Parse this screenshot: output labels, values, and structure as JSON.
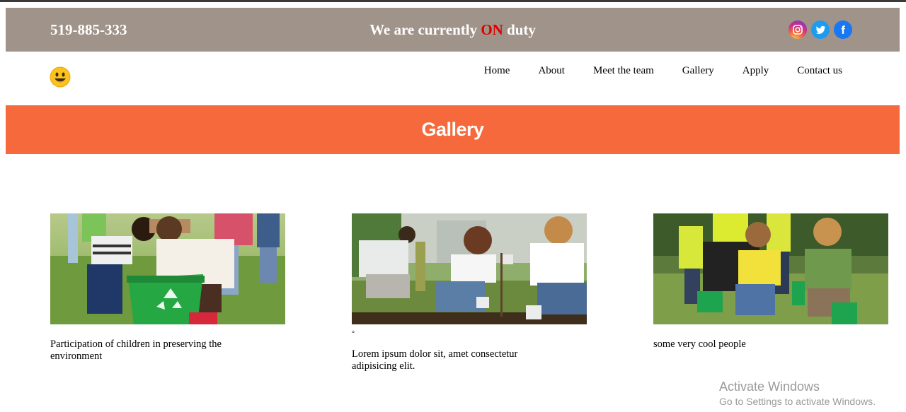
{
  "header": {
    "phone": "519-885-333",
    "duty_prefix": "We are currently ",
    "duty_highlight": "ON",
    "duty_suffix": " duty",
    "highlight_color": "#e00000",
    "bar_color": "#a09389",
    "socials": [
      {
        "icon": "instagram-icon"
      },
      {
        "icon": "twitter-icon"
      },
      {
        "icon": "facebook-icon"
      }
    ]
  },
  "nav": {
    "logo_icon": "smiley-icon",
    "items": [
      {
        "label": "Home"
      },
      {
        "label": "About"
      },
      {
        "label": "Meet the team"
      },
      {
        "label": "Gallery"
      },
      {
        "label": "Apply"
      },
      {
        "label": "Contact us"
      }
    ]
  },
  "banner": {
    "title": "Gallery",
    "color": "#f5693c"
  },
  "gallery": [
    {
      "caption": "Participation of children in preserving the environment"
    },
    {
      "marker": "°",
      "caption": "Lorem ipsum dolor sit, amet consectetur adipisicing elit."
    },
    {
      "caption": "some very cool people"
    }
  ],
  "os_watermark": {
    "title": "Activate Windows",
    "subtitle": "Go to Settings to activate Windows."
  }
}
